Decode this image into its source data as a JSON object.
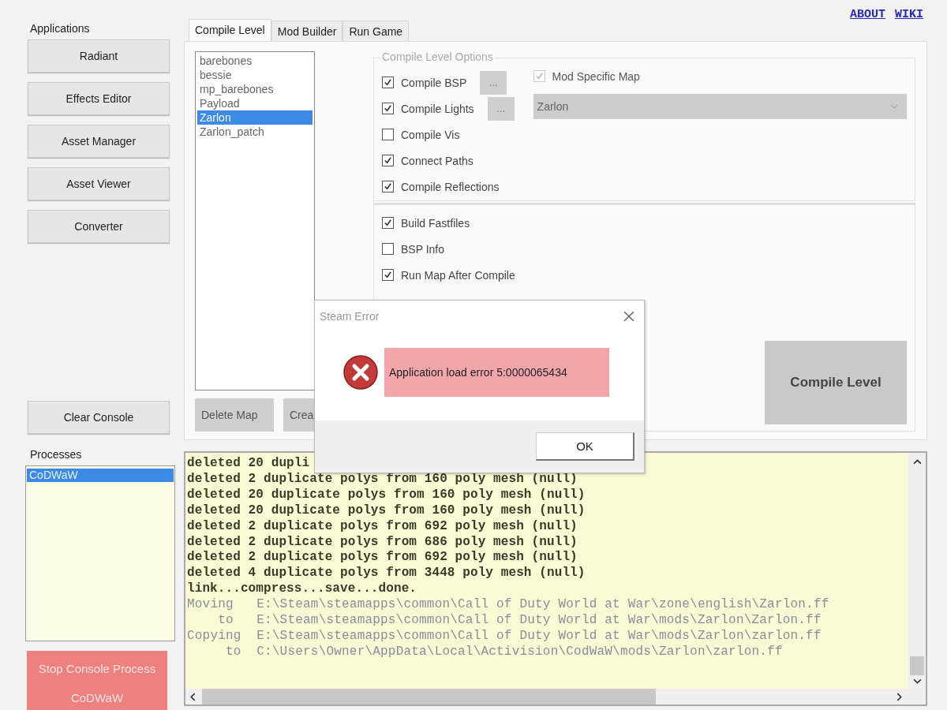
{
  "links": [
    "ABOUT",
    "WIKI"
  ],
  "applications": {
    "title": "Applications",
    "buttons": [
      "Radiant",
      "Effects Editor",
      "Asset Manager",
      "Asset Viewer",
      "Converter"
    ],
    "clear_button": "Clear Console"
  },
  "tabs": [
    {
      "label": "Compile Level",
      "selected": true
    },
    {
      "label": "Mod Builder",
      "selected": false
    },
    {
      "label": "Run Game",
      "selected": false
    }
  ],
  "maps": [
    {
      "name": "barebones",
      "selected": false
    },
    {
      "name": "bessie",
      "selected": false
    },
    {
      "name": "mp_barebones",
      "selected": false
    },
    {
      "name": "Payload",
      "selected": false
    },
    {
      "name": "Zarlon",
      "selected": true
    },
    {
      "name": "Zarlon_patch",
      "selected": false
    }
  ],
  "map_buttons": [
    "Delete Map",
    "Crea"
  ],
  "options": {
    "title": "Compile Level Options",
    "items": [
      {
        "label": "Compile BSP",
        "checked": true,
        "settings_button": "..."
      },
      {
        "label": "Compile Lights",
        "checked": true,
        "settings_button": "..."
      },
      {
        "label": "Compile Vis",
        "checked": false
      },
      {
        "label": "Connect Paths",
        "checked": true
      },
      {
        "label": "Compile Reflections",
        "checked": true
      }
    ],
    "mod_specific": {
      "label": "Mod Specific Map",
      "checked": true,
      "disabled": true
    },
    "mod_select": {
      "value": "Zarlon",
      "disabled": true
    },
    "build_items": [
      {
        "label": "Build Fastfiles",
        "checked": true
      },
      {
        "label": "BSP Info",
        "checked": false
      },
      {
        "label": "Run Map After Compile",
        "checked": true
      }
    ]
  },
  "compile_button": "Compile Level",
  "processes": {
    "title": "Processes",
    "items": [
      {
        "name": "CoDWaW",
        "selected": true
      }
    ],
    "stop_button": [
      "Stop Console Process",
      "CoDWaW"
    ]
  },
  "console": {
    "lines": [
      {
        "text": "deleted 20 dupli",
        "kind": "output"
      },
      {
        "text": "deleted 2 duplicate polys from 160 poly mesh (null)",
        "kind": "output"
      },
      {
        "text": "deleted 20 duplicate polys from 160 poly mesh (null)",
        "kind": "output"
      },
      {
        "text": "deleted 20 duplicate polys from 160 poly mesh (null)",
        "kind": "output"
      },
      {
        "text": "deleted 2 duplicate polys from 692 poly mesh (null)",
        "kind": "output"
      },
      {
        "text": "deleted 2 duplicate polys from 686 poly mesh (null)",
        "kind": "output"
      },
      {
        "text": "deleted 2 duplicate polys from 692 poly mesh (null)",
        "kind": "output"
      },
      {
        "text": "deleted 4 duplicate polys from 3448 poly mesh (null)",
        "kind": "output"
      },
      {
        "text": "link...compress...save...done.",
        "kind": "output"
      },
      {
        "text": "Moving   E:\\Steam\\steamapps\\common\\Call of Duty World at War\\zone\\english\\Zarlon.ff",
        "kind": "file"
      },
      {
        "text": "    to   E:\\Steam\\steamapps\\common\\Call of Duty World at War\\mods\\Zarlon\\Zarlon.ff",
        "kind": "file"
      },
      {
        "text": "Copying  E:\\Steam\\steamapps\\common\\Call of Duty World at War\\mods\\Zarlon\\zarlon.ff",
        "kind": "file"
      },
      {
        "text": "     to  C:\\Users\\Owner\\AppData\\Local\\Activision\\CodWaW\\mods\\Zarlon\\zarlon.ff",
        "kind": "file"
      }
    ]
  },
  "dialog": {
    "title": "Steam Error",
    "message": "Application load error 5:0000065434",
    "button": "OK"
  }
}
